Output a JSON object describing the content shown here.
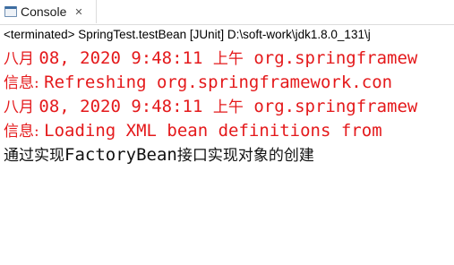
{
  "tab": {
    "label": "Console",
    "close": "✕",
    "icon": "console-icon"
  },
  "status": "<terminated> SpringTest.testBean [JUnit] D:\\soft-work\\jdk1.8.0_131\\j",
  "colors": {
    "error": "#e4191b",
    "output": "#111111"
  },
  "lines": [
    {
      "prefix": "八月 ",
      "mono": "08, 2020 9:48:11 ",
      "suffix": "上午",
      "tail": " org.springframew"
    },
    {
      "prefix": "信息: ",
      "mono": "Refreshing org.springframework.con"
    },
    {
      "prefix": "八月 ",
      "mono": "08, 2020 9:48:11 ",
      "suffix": "上午",
      "tail": " org.springframew"
    },
    {
      "prefix": "信息: ",
      "mono": "Loading XML bean definitions from "
    },
    {
      "prefix": "通过实现",
      "mono": "FactoryBean",
      "suffix": "接口实现对象的创建"
    }
  ]
}
